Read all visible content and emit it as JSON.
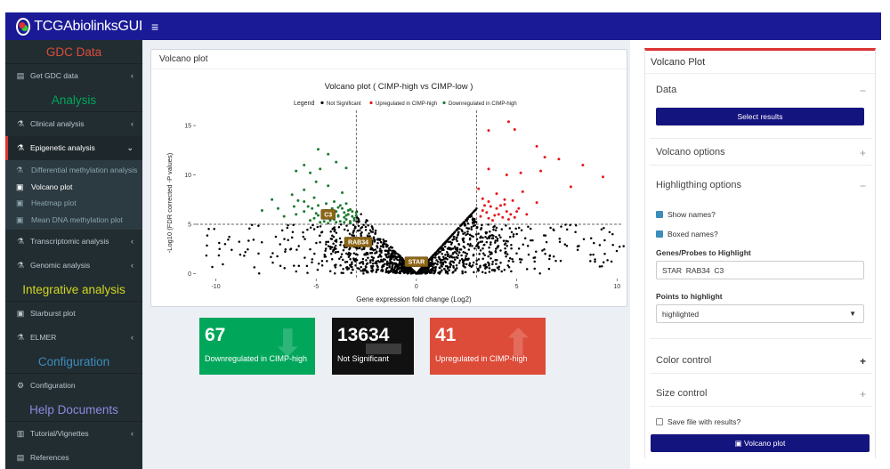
{
  "header": {
    "brand": "TCGAbiolinksGUI",
    "menu_icon": "hamburger-icon"
  },
  "sidebar": {
    "sections": [
      {
        "title": "GDC Data",
        "color": "#dd4b39"
      },
      {
        "title": "Analysis",
        "color": "#00a65a"
      },
      {
        "title": "Integrative analysis",
        "color": "#d2d61e"
      },
      {
        "title": "Configuration",
        "color": "#3c8dbc"
      },
      {
        "title": "Help Documents",
        "color": "#8a8ae0"
      }
    ],
    "items": {
      "get_gdc": "Get GDC data",
      "clinical": "Clinical analysis",
      "epigenetic": "Epigenetic analysis",
      "sub_diffmeth": "Differential methylation analysis",
      "sub_volcano": "Volcano plot",
      "sub_heatmap": "Heatmap plot",
      "sub_meandna": "Mean DNA methylation plot",
      "transcriptomic": "Transcriptomic analysis",
      "genomic": "Genomic analysis",
      "starburst": "Starburst plot",
      "elmer": "ELMER",
      "configuration": "Configuration",
      "tutorial": "Tutorial/Vignettes",
      "references": "References"
    }
  },
  "main": {
    "box_title": "Volcano plot",
    "info_boxes": [
      {
        "value": "67",
        "label": "Downregulated in CIMP-high",
        "color": "#00a65a",
        "icon": "arrow-down-icon"
      },
      {
        "value": "13634",
        "label": "Not Significant",
        "color": "#111111",
        "icon": "minus-icon"
      },
      {
        "value": "41",
        "label": "Upregulated in CIMP-high",
        "color": "#dd4b39",
        "icon": "arrow-up-icon"
      }
    ]
  },
  "chart_data": {
    "type": "scatter",
    "title": "Volcano plot ( CIMP-high vs CIMP-low )",
    "xlabel": "Gene expression fold change (Log2)",
    "ylabel": "-Log10 (FDR corrected -P values)",
    "xlim": [
      -11,
      10.3
    ],
    "ylim": [
      -0.5,
      16
    ],
    "xticks": [
      -10,
      -5,
      0,
      5,
      10
    ],
    "yticks": [
      0,
      5,
      10,
      15
    ],
    "legend": {
      "title": "Legend",
      "entries": [
        {
          "name": "Not Significant",
          "color": "#000000"
        },
        {
          "name": "Upregulated in CIMP-high",
          "color": "#e41a1c"
        },
        {
          "name": "Downregulated in CIMP-high",
          "color": "#1b7a2e"
        }
      ],
      "position": "top"
    },
    "thresholds": {
      "x": [
        -3,
        3
      ],
      "y": 5
    },
    "highlighted": [
      {
        "label": "C3",
        "x": -4.4,
        "y": 6.0
      },
      {
        "label": "RAB34",
        "x": -2.9,
        "y": 3.2
      },
      {
        "label": "STAR",
        "x": 0,
        "y": 1.2
      }
    ],
    "series": [
      {
        "name": "Upregulated in CIMP-high",
        "points": [
          [
            3.6,
            14.5
          ],
          [
            4.6,
            15.4
          ],
          [
            4.9,
            14.6
          ],
          [
            6.0,
            12.9
          ],
          [
            6.4,
            11.8
          ],
          [
            7.1,
            11.6
          ],
          [
            8.3,
            11.0
          ],
          [
            9.3,
            9.8
          ],
          [
            7.7,
            8.8
          ],
          [
            3.6,
            10.6
          ],
          [
            4.5,
            10.0
          ],
          [
            5.2,
            10.2
          ],
          [
            6.2,
            10.4
          ],
          [
            5.3,
            8.3
          ],
          [
            3.1,
            8.6
          ],
          [
            4.0,
            8.1
          ],
          [
            4.4,
            7.5
          ],
          [
            3.6,
            7.3
          ],
          [
            4.8,
            7.4
          ],
          [
            4.0,
            6.6
          ],
          [
            4.5,
            6.3
          ],
          [
            5.0,
            6.3
          ],
          [
            3.3,
            6.4
          ],
          [
            3.9,
            5.9
          ],
          [
            4.3,
            5.7
          ],
          [
            3.6,
            5.6
          ],
          [
            4.7,
            6.0
          ],
          [
            6.0,
            7.2
          ],
          [
            3.3,
            7.6
          ],
          [
            4.2,
            6.9
          ],
          [
            3.5,
            6.2
          ],
          [
            4.9,
            5.7
          ],
          [
            3.8,
            5.4
          ],
          [
            4.1,
            6.0
          ],
          [
            3.2,
            5.8
          ],
          [
            5.5,
            6.0
          ],
          [
            4.4,
            7.0
          ],
          [
            3.7,
            6.8
          ],
          [
            5.1,
            6.6
          ],
          [
            4.6,
            5.5
          ],
          [
            3.4,
            6.9
          ]
        ]
      },
      {
        "name": "Downregulated in CIMP-high",
        "points": [
          [
            -4.9,
            12.6
          ],
          [
            -4.4,
            12.1
          ],
          [
            -4.0,
            11.3
          ],
          [
            -5.6,
            11.0
          ],
          [
            -5.3,
            10.2
          ],
          [
            -6.0,
            10.4
          ],
          [
            -4.8,
            10.6
          ],
          [
            -3.5,
            10.7
          ],
          [
            -5.0,
            9.3
          ],
          [
            -5.6,
            8.5
          ],
          [
            -4.4,
            8.9
          ],
          [
            -3.7,
            8.2
          ],
          [
            -6.2,
            8.0
          ],
          [
            -7.2,
            7.5
          ],
          [
            -5.1,
            7.7
          ],
          [
            -4.1,
            7.3
          ],
          [
            -3.5,
            7.1
          ],
          [
            -4.9,
            6.9
          ],
          [
            -3.9,
            6.7
          ],
          [
            -5.4,
            6.8
          ],
          [
            -6.9,
            6.6
          ],
          [
            -3.3,
            6.5
          ],
          [
            -4.5,
            6.4
          ],
          [
            -3.6,
            6.2
          ],
          [
            -5.0,
            6.1
          ],
          [
            -4.2,
            6.0
          ],
          [
            -3.9,
            5.9
          ],
          [
            -5.6,
            6.3
          ],
          [
            -6.6,
            5.8
          ],
          [
            -4.6,
            5.7
          ],
          [
            -3.2,
            5.8
          ],
          [
            -3.5,
            5.5
          ],
          [
            -4.3,
            5.4
          ],
          [
            -3.8,
            5.3
          ],
          [
            -5.1,
            5.6
          ],
          [
            -4.0,
            5.2
          ],
          [
            -3.3,
            5.3
          ],
          [
            -4.8,
            5.2
          ],
          [
            -7.7,
            6.4
          ],
          [
            -6.1,
            6.8
          ],
          [
            -3.1,
            5.6
          ],
          [
            -3.7,
            6.6
          ],
          [
            -4.5,
            7.1
          ],
          [
            -5.9,
            7.4
          ],
          [
            -3.4,
            6.0
          ],
          [
            -3.0,
            5.9
          ],
          [
            -4.1,
            5.5
          ],
          [
            -3.6,
            5.2
          ],
          [
            -3.2,
            6.3
          ],
          [
            -4.7,
            6.0
          ],
          [
            -5.3,
            5.4
          ],
          [
            -3.9,
            5.8
          ],
          [
            -3.5,
            5.9
          ],
          [
            -4.2,
            6.6
          ],
          [
            -3.0,
            6.2
          ],
          [
            -5.6,
            7.3
          ],
          [
            -6.0,
            6.0
          ],
          [
            -3.3,
            5.1
          ],
          [
            -4.4,
            5.1
          ],
          [
            -3.8,
            6.9
          ],
          [
            -4.9,
            5.9
          ],
          [
            -3.1,
            5.4
          ],
          [
            -4.0,
            6.3
          ],
          [
            -5.2,
            6.6
          ],
          [
            -3.6,
            5.7
          ],
          [
            -4.6,
            5.3
          ],
          [
            -3.4,
            6.4
          ]
        ]
      }
    ],
    "not_significant_count": 13634
  },
  "panel": {
    "title": "Volcano Plot",
    "sections": {
      "data": "Data",
      "volcano_options": "Volcano options",
      "highlight_options": "Highligthing options",
      "color_control": "Color control",
      "size_control": "Size control"
    },
    "select_results": "Select results",
    "show_names": "Show names?",
    "boxed_names": "Boxed names?",
    "genes_label": "Genes/Probes to Highlight",
    "genes_value": "STAR  RAB34  C3",
    "points_label": "Points to highlight",
    "points_value": "highlighted",
    "save_file": "Save file with results?",
    "plot_button": "Volcano plot"
  }
}
